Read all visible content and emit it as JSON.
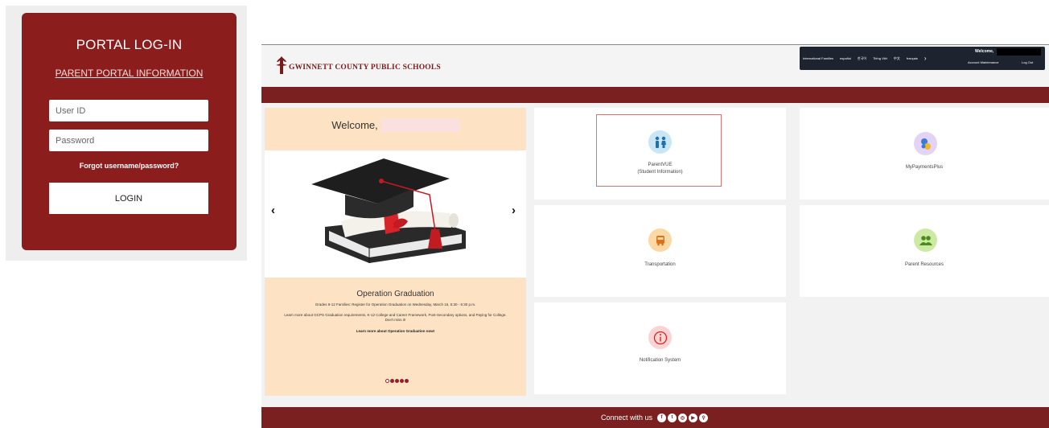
{
  "login": {
    "title": "PORTAL LOG-IN",
    "info_link": "PARENT PORTAL INFORMATION",
    "user_placeholder": "User ID",
    "password_placeholder": "Password",
    "forgot": "Forgot username/password?",
    "login_button": "LOGIN"
  },
  "portal": {
    "brand": "GWINNETT COUNTY PUBLIC SCHOOLS",
    "utility_bar": {
      "items": [
        "International Families",
        "español",
        "한국어",
        "Tiếng Việt",
        "中文",
        "français"
      ],
      "welcome": "Welcome,",
      "account": "Account Maintenance",
      "logout": "Log Out"
    },
    "welcome_label": "Welcome,",
    "slide": {
      "title": "Operation Graduation",
      "p1": "Grades 9-12 Families: Register for Operation Graduation on Wednesday, March 15, 5:30 - 6:30 p.m.",
      "p2": "Learn more about GCPS Graduation requirements, K-12 College and Career Framework, Post-Secondary options, and Paying for College. Don't miss it!",
      "link": "Learn more about Operation Graduation now!",
      "prev": "‹",
      "next": "›"
    },
    "tiles": {
      "parentvue_line1": "ParentVUE",
      "parentvue_line2": "(Student Information)",
      "mpp": "MyPaymentsPlus",
      "transport": "Transportation",
      "resources": "Parent Resources",
      "notify": "Notification System"
    },
    "footer": "Connect with us"
  },
  "colors": {
    "brand_red": "#8b1d1d",
    "band_red": "#7a2020",
    "welcome_bg": "#fde3c3"
  },
  "icons": {
    "parentvue": "family-icon",
    "mpp": "payments-icon",
    "transport": "bus-icon",
    "resources": "people-icon",
    "notify": "info-icon",
    "social": [
      "facebook-icon",
      "twitter-icon",
      "instagram-icon",
      "youtube-icon",
      "link-icon"
    ]
  }
}
